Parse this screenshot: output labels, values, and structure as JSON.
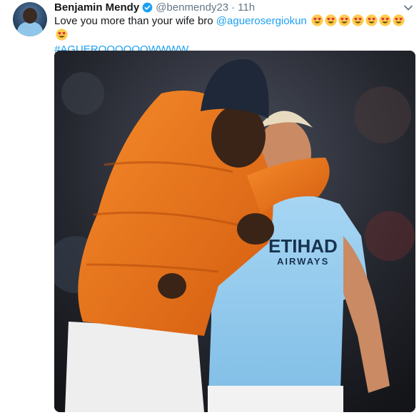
{
  "tweet": {
    "author_name": "Benjamin Mendy",
    "handle": "@benmendy23",
    "separator": "·",
    "time": "11h",
    "text_before_mention": "Love you more than your wife bro ",
    "mention": "@aguerosergiokun",
    "emoji_name": "heart-eyes-emoji",
    "emoji_count": 8,
    "hashtag": "#AGUEROOOOOOWWWW",
    "photo_jersey_text_main": "ETIHAD",
    "photo_jersey_text_sub": "AIRWAYS",
    "colors": {
      "link": "#1da1f2",
      "name": "#14171a",
      "meta": "#657786",
      "verified": "#1da1f2"
    }
  }
}
